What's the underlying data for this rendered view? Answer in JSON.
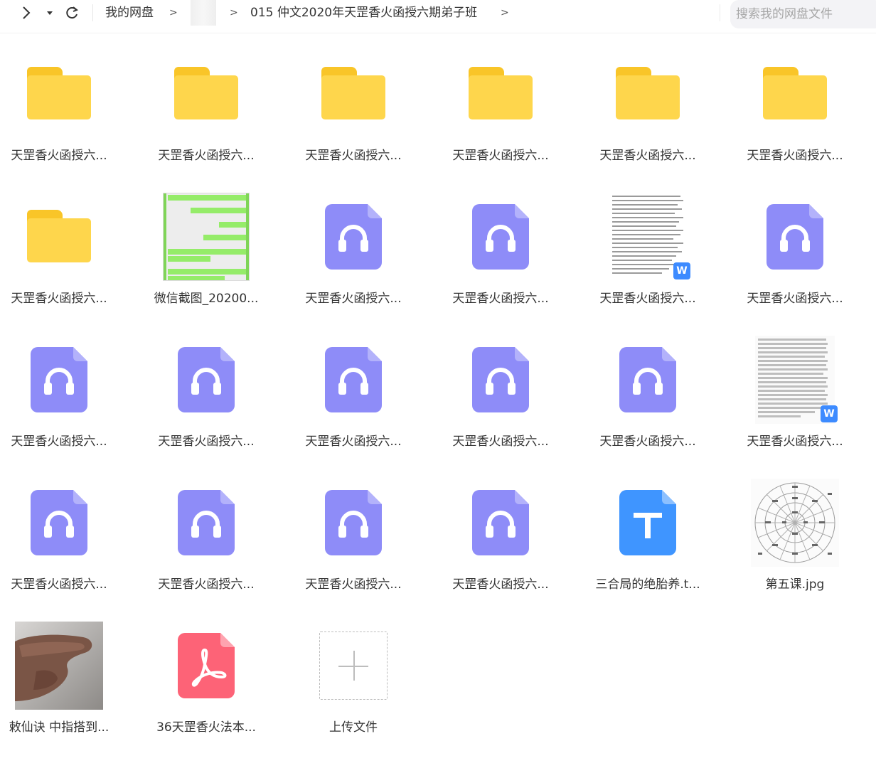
{
  "breadcrumb": {
    "root": "我的网盘",
    "sep": ">",
    "current": "015 仲文2020年天罡香火函授六期弟子班"
  },
  "search": {
    "placeholder": "搜索我的网盘文件"
  },
  "colors": {
    "folder_body": "#fed64c",
    "folder_tab": "#f9c528",
    "audio_icon": "#8e8cf8",
    "text_icon": "#3f95ff",
    "pdf_icon": "#fd6377",
    "doc_badge": "#3d8bff"
  },
  "files": [
    {
      "name": "天罡香火函授六...",
      "icon": "folder-icon"
    },
    {
      "name": "天罡香火函授六...",
      "icon": "folder-icon"
    },
    {
      "name": "天罡香火函授六...",
      "icon": "folder-icon"
    },
    {
      "name": "天罡香火函授六...",
      "icon": "folder-icon"
    },
    {
      "name": "天罡香火函授六...",
      "icon": "folder-icon"
    },
    {
      "name": "天罡香火函授六...",
      "icon": "folder-icon"
    },
    {
      "name": "天罡香火函授六...",
      "icon": "folder-icon"
    },
    {
      "name": "微信截图_20200...",
      "icon": "chat-screenshot-thumbnail"
    },
    {
      "name": "天罡香火函授六...",
      "icon": "audio-file-icon"
    },
    {
      "name": "天罡香火函授六...",
      "icon": "audio-file-icon"
    },
    {
      "name": "天罡香火函授六...",
      "icon": "word-doc-thumbnail"
    },
    {
      "name": "天罡香火函授六...",
      "icon": "audio-file-icon"
    },
    {
      "name": "天罡香火函授六...",
      "icon": "audio-file-icon"
    },
    {
      "name": "天罡香火函授六...",
      "icon": "audio-file-icon"
    },
    {
      "name": "天罡香火函授六...",
      "icon": "audio-file-icon"
    },
    {
      "name": "天罡香火函授六...",
      "icon": "audio-file-icon"
    },
    {
      "name": "天罡香火函授六...",
      "icon": "audio-file-icon"
    },
    {
      "name": "天罡香火函授六...",
      "icon": "word-doc-thumbnail"
    },
    {
      "name": "天罡香火函授六...",
      "icon": "audio-file-icon"
    },
    {
      "name": "天罡香火函授六...",
      "icon": "audio-file-icon"
    },
    {
      "name": "天罡香火函授六...",
      "icon": "audio-file-icon"
    },
    {
      "name": "天罡香火函授六...",
      "icon": "audio-file-icon"
    },
    {
      "name": "三合局的绝胎养.t...",
      "icon": "text-file-icon"
    },
    {
      "name": "第五课.jpg",
      "icon": "wheel-diagram-thumbnail"
    },
    {
      "name": "敕仙诀 中指搭到...",
      "icon": "hand-photo-thumbnail"
    },
    {
      "name": "36天罡香火法本...",
      "icon": "pdf-file-icon"
    }
  ],
  "upload": {
    "label": "上传文件"
  }
}
